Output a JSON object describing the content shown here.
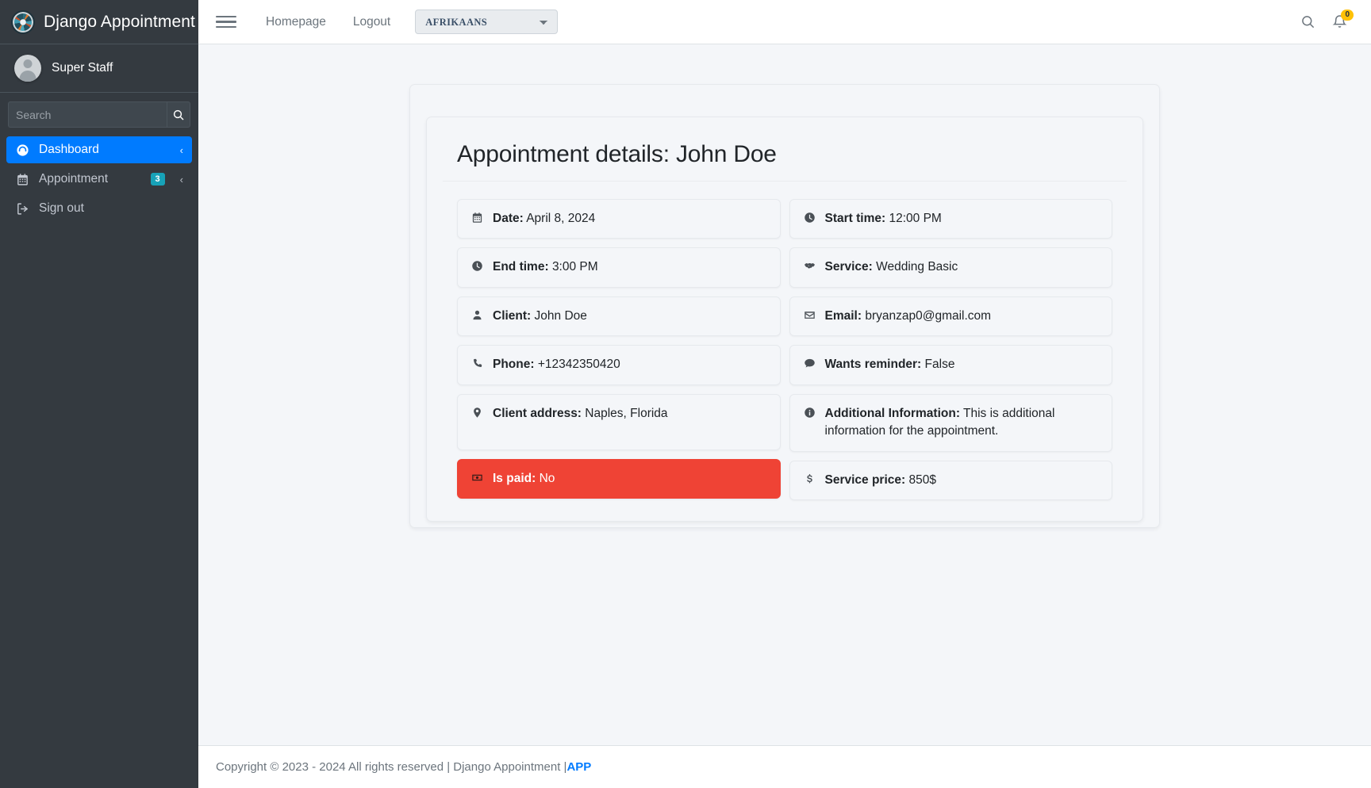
{
  "sidebar": {
    "brand_title": "Django Appointment",
    "logo_icon": "django-circular-logo",
    "user_name": "Super Staff",
    "search_placeholder": "Search",
    "search_value": "",
    "search_icon": "search-icon",
    "items": [
      {
        "label": "Dashboard",
        "icon": "tachometer-icon",
        "active": true,
        "badge": "",
        "arrow": "‹"
      },
      {
        "label": "Appointment",
        "icon": "calendar-icon",
        "active": false,
        "badge": "3",
        "arrow": "‹"
      },
      {
        "label": "Sign out",
        "icon": "sign-out-icon",
        "active": false,
        "badge": "",
        "arrow": ""
      }
    ]
  },
  "navbar": {
    "menu_icon": "hamburger-icon",
    "links": [
      {
        "label": "Homepage"
      },
      {
        "label": "Logout"
      }
    ],
    "language_selected": "AFRIKAANS",
    "language_options": [
      "AFRIKAANS"
    ],
    "search_icon": "search-icon",
    "bell_icon": "bell-icon",
    "notification_count": "0"
  },
  "page": {
    "title": "Appointment details: John Doe",
    "left_column": [
      {
        "icon": "calendar-icon",
        "label": "Date:",
        "value": "April 8, 2024",
        "style": "normal"
      },
      {
        "icon": "clock-icon",
        "label": "End time:",
        "value": "3:00 PM",
        "style": "normal"
      },
      {
        "icon": "user-icon",
        "label": "Client:",
        "value": "John Doe",
        "style": "normal"
      },
      {
        "icon": "phone-icon",
        "label": "Phone:",
        "value": "+12342350420",
        "style": "normal"
      },
      {
        "icon": "map-marker-icon",
        "label": "Client address:",
        "value": "Naples, Florida",
        "style": "tall"
      },
      {
        "icon": "money-bill-icon",
        "label": "Is paid:",
        "value": "No",
        "style": "danger"
      }
    ],
    "right_column": [
      {
        "icon": "clock-icon",
        "label": "Start time:",
        "value": "12:00 PM",
        "style": "normal"
      },
      {
        "icon": "handshake-icon",
        "label": "Service:",
        "value": "Wedding Basic",
        "style": "normal"
      },
      {
        "icon": "envelope-icon",
        "label": "Email:",
        "value": "bryanzap0@gmail.com",
        "style": "normal"
      },
      {
        "icon": "comment-icon",
        "label": "Wants reminder:",
        "value": "False",
        "style": "normal"
      },
      {
        "icon": "info-circle-icon",
        "label": "Additional Information:",
        "value": "This is additional information for the appointment.",
        "style": "tall"
      },
      {
        "icon": "dollar-icon",
        "label": "Service price:",
        "value": "850$",
        "style": "normal"
      }
    ]
  },
  "footer": {
    "text": "Copyright © 2023 - 2024 All rights reserved | Django Appointment | ",
    "link_label": "APP"
  },
  "colors": {
    "sidebar_bg": "#343a40",
    "accent_blue": "#007bff",
    "badge_teal": "#17a2b8",
    "danger_red": "#ef4335",
    "notif_yellow": "#ffc107",
    "content_bg": "#f4f6f9"
  }
}
